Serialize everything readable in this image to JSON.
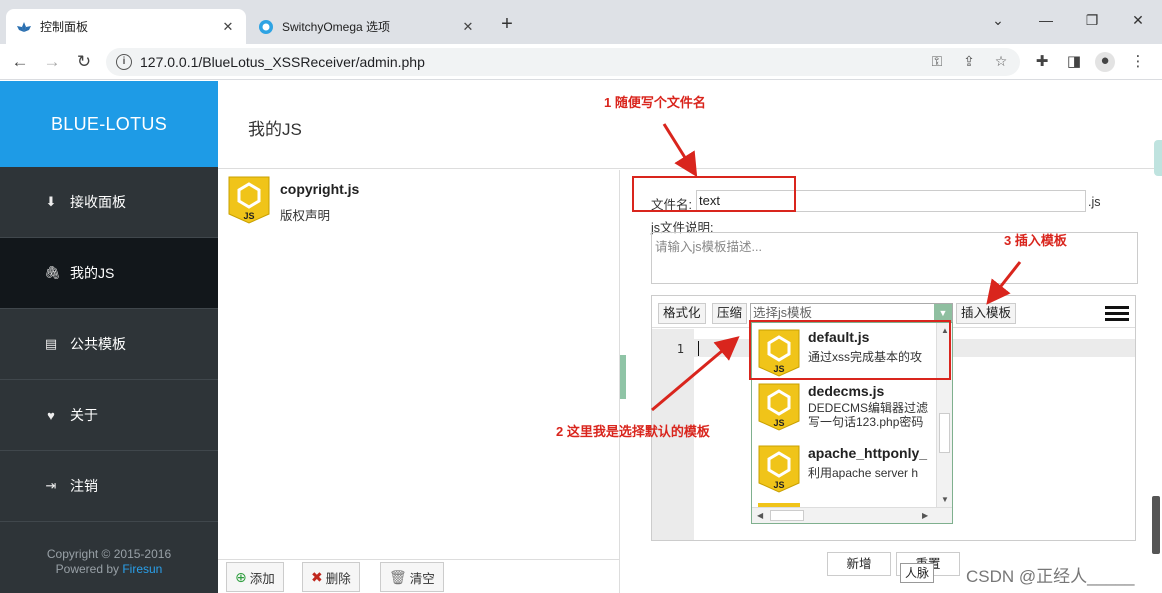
{
  "browser": {
    "tabs": [
      {
        "title": "控制面板",
        "icon": "lotus-favicon",
        "active": true
      },
      {
        "title": "SwitchyOmega 选项",
        "icon": "switchyomega-favicon",
        "active": false
      }
    ],
    "new_tab_glyph": "+",
    "url": "127.0.0.1/BlueLotus_XSSReceiver/admin.php"
  },
  "sidebar": {
    "brand": "BLUE-LOTUS",
    "items": [
      {
        "label": "接收面板",
        "icon": "download-tray-icon"
      },
      {
        "label": "我的JS",
        "icon": "paperclip-icon",
        "active": true
      },
      {
        "label": "公共模板",
        "icon": "document-icon"
      },
      {
        "label": "关于",
        "icon": "heart-icon"
      },
      {
        "label": "注销",
        "icon": "sign-out-icon"
      }
    ],
    "copyright_line1": "Copyright © 2015-2016",
    "powered_prefix": "Powered by ",
    "powered_link": "Firesun"
  },
  "header": {
    "title": "我的JS"
  },
  "js_list": {
    "items": [
      {
        "name": "copyright.js",
        "desc": "版权声明"
      }
    ],
    "buttons": {
      "add": "添加",
      "delete": "删除",
      "clear": "清空"
    }
  },
  "editor": {
    "filename_label": "文件名:",
    "filename_value": "text",
    "filename_suffix": ".js",
    "desc_label": "js文件说明:",
    "desc_placeholder": "请输入js模板描述...",
    "toolbar": {
      "format": "格式化",
      "compress": "压缩",
      "select_placeholder": "选择js模板",
      "insert": "插入模板"
    },
    "line_number": "1",
    "templates": [
      {
        "name": "default.js",
        "desc": "通过xss完成基本的攻"
      },
      {
        "name": "dedecms.js",
        "desc": "DEDECMS编辑器过滤",
        "desc2": "写一句话123.php密码"
      },
      {
        "name": "apache_httponly_",
        "desc": "利用apache server h"
      }
    ],
    "buttons": {
      "add": "新增",
      "reset": "重置"
    }
  },
  "annotations": {
    "step1": "1   随便写个文件名",
    "step2": "2 这里我是选择默认的模板",
    "step3": "3 插入模板",
    "color": "#d9251d"
  },
  "ime_tip": "人脉",
  "watermark": "CSDN @正经人_____",
  "colors": {
    "brand": "#1e9be6",
    "sidebar": "#2e3438",
    "sidebar_active": "#12171b",
    "accent_green": "#8fbfa0",
    "badge_yellow": "#f0c419"
  }
}
